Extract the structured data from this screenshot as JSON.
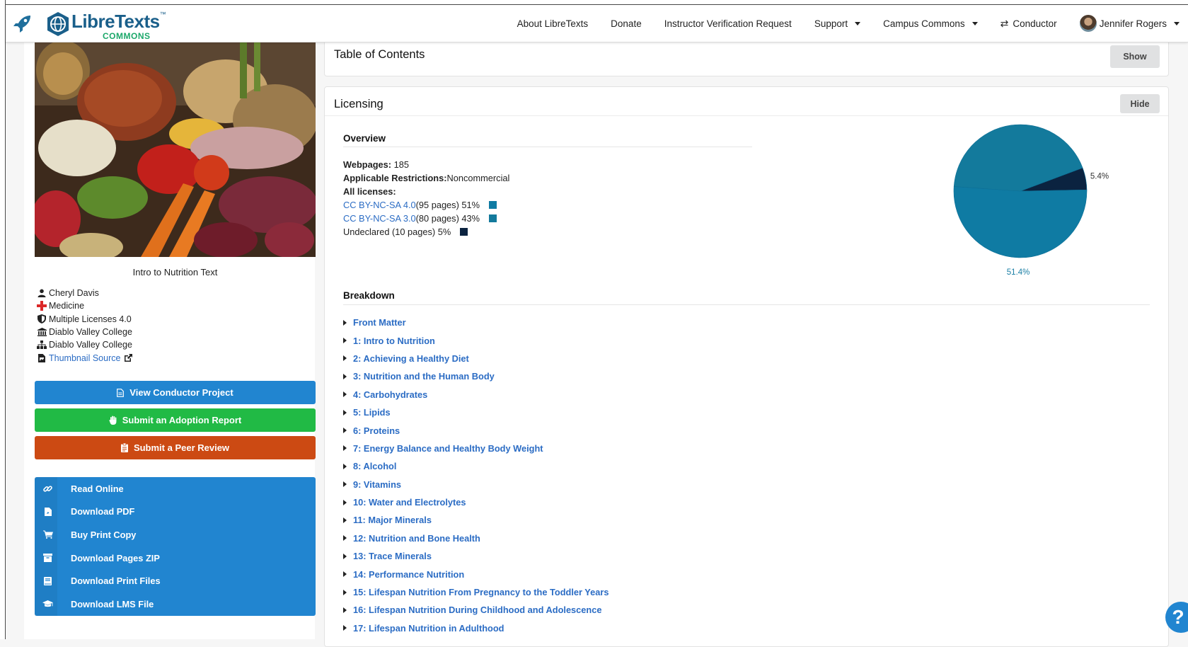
{
  "navbar": {
    "brand_name": "LibreTexts",
    "brand_sub": "COMMONS",
    "links": [
      {
        "label": "About LibreTexts",
        "dropdown": false
      },
      {
        "label": "Donate",
        "dropdown": false
      },
      {
        "label": "Instructor Verification Request",
        "dropdown": false
      },
      {
        "label": "Support",
        "dropdown": true
      },
      {
        "label": "Campus Commons",
        "dropdown": true
      }
    ],
    "conductor_label": "Conductor",
    "user_name": "Jennifer Rogers"
  },
  "book": {
    "title": "Intro to Nutrition Text",
    "meta": [
      {
        "icon": "user-icon",
        "text": "Cheryl Davis",
        "link": false
      },
      {
        "icon": "medical-cross-icon",
        "text": "Medicine",
        "link": false
      },
      {
        "icon": "shield-icon",
        "text": "Multiple Licenses 4.0",
        "link": false
      },
      {
        "icon": "university-icon",
        "text": "Diablo Valley College",
        "link": false
      },
      {
        "icon": "sitemap-icon",
        "text": "Diablo Valley College",
        "link": false
      },
      {
        "icon": "file-image-icon",
        "text": "Thumbnail Source",
        "link": true
      }
    ]
  },
  "actions": {
    "view_conductor": "View Conductor Project",
    "adoption_report": "Submit an Adoption Report",
    "peer_review": "Submit a Peer Review"
  },
  "resources": [
    {
      "icon": "link-icon",
      "label": "Read Online"
    },
    {
      "icon": "file-pdf-icon",
      "label": "Download PDF"
    },
    {
      "icon": "cart-icon",
      "label": "Buy Print Copy"
    },
    {
      "icon": "archive-icon",
      "label": "Download Pages ZIP"
    },
    {
      "icon": "book-icon",
      "label": "Download Print Files"
    },
    {
      "icon": "graduation-cap-icon",
      "label": "Download LMS File"
    }
  ],
  "toc": {
    "title": "Table of Contents",
    "button": "Show"
  },
  "licensing": {
    "title": "Licensing",
    "button": "Hide",
    "overview_title": "Overview",
    "webpages_label": "Webpages:",
    "webpages_value": "185",
    "restrictions_label": "Applicable Restrictions:",
    "restrictions_value": "Noncommercial",
    "all_licenses_label": "All licenses:",
    "licenses": [
      {
        "link": "CC BY-NC-SA 4.0",
        "rest": "(95 pages) 51%",
        "color": "#0f7ba3"
      },
      {
        "link": "CC BY-NC-SA 3.0",
        "rest": "(80 pages) 43%",
        "color": "#137a9c"
      },
      {
        "link": "",
        "rest": "Undeclared (10 pages) 5%",
        "color": "#0b2340"
      }
    ],
    "breakdown_title": "Breakdown",
    "chapters": [
      "Front Matter",
      "1: Intro to Nutrition",
      "2: Achieving a Healthy Diet",
      "3: Nutrition and the Human Body",
      "4: Carbohydrates",
      "5: Lipids",
      "6: Proteins",
      "7: Energy Balance and Healthy Body Weight",
      "8: Alcohol",
      "9: Vitamins",
      "10: Water and Electrolytes",
      "11: Major Minerals",
      "12: Nutrition and Bone Health",
      "13: Trace Minerals",
      "14: Performance Nutrition",
      "15: Lifespan Nutrition From Pregnancy to the Toddler Years",
      "16: Lifespan Nutrition During Childhood and Adolescence",
      "17: Lifespan Nutrition in Adulthood"
    ]
  },
  "chart_data": {
    "type": "pie",
    "slices": [
      {
        "label": "CC BY-NC-SA 4.0",
        "value": 51.4,
        "display": "51.4%",
        "color": "#0f7ba3"
      },
      {
        "label": "CC BY-NC-SA 3.0",
        "value": 43.2,
        "display": "43.2%",
        "color": "#137a9c"
      },
      {
        "label": "Undeclared",
        "value": 5.4,
        "display": "5.4%",
        "color": "#0b2340"
      }
    ]
  },
  "help_label": "?"
}
